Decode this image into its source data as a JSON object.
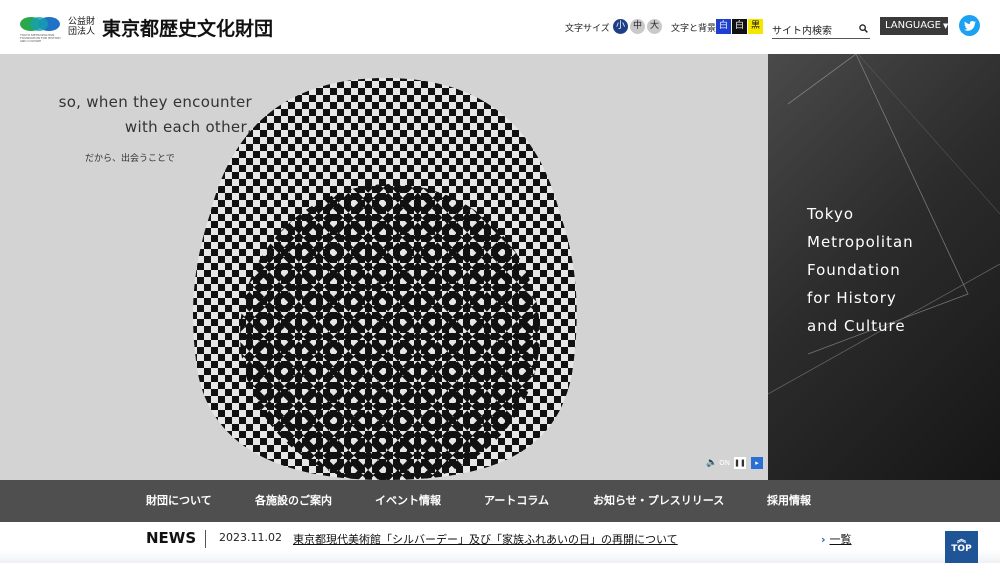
{
  "header": {
    "logo_small": "公益財団法人",
    "logo_main": "東京都歴史文化財団",
    "logo_sub": "TOKYO METROPOLITAN FOUNDATION FOR HISTORY AND CULTURE",
    "font_size_label": "文字サイズ",
    "font_sizes": [
      "小",
      "中",
      "大"
    ],
    "bg_label": "文字と背景",
    "bg_options": [
      "白",
      "白",
      "黒"
    ],
    "search_placeholder": "サイト内検索",
    "language_label": "LANGUAGE",
    "twitter_icon": "twitter-icon"
  },
  "hero": {
    "en_line1": "so, when they encounter",
    "en_line2": "with each other,",
    "jp_line": "だから、出会うことで",
    "sound_label": "ON"
  },
  "side": {
    "title_lines": [
      "Tokyo",
      "Metropolitan",
      "Foundation",
      "for History",
      "and Culture"
    ]
  },
  "nav": {
    "items": [
      "財団について",
      "各施設のご案内",
      "イベント情報",
      "アートコラム",
      "お知らせ・プレスリリース",
      "採用情報"
    ]
  },
  "news": {
    "label": "NEWS",
    "date": "2023.11.02",
    "headline": "東京都現代美術館「シルバーデー」及び「家族ふれあいの日」の再開について",
    "more_label": "一覧",
    "top_label": "TOP"
  },
  "colors": {
    "accent_blue": "#1e3f86",
    "nav_bg": "#4f4f4f",
    "twitter": "#1da1f2",
    "top_button": "#1f5596"
  }
}
